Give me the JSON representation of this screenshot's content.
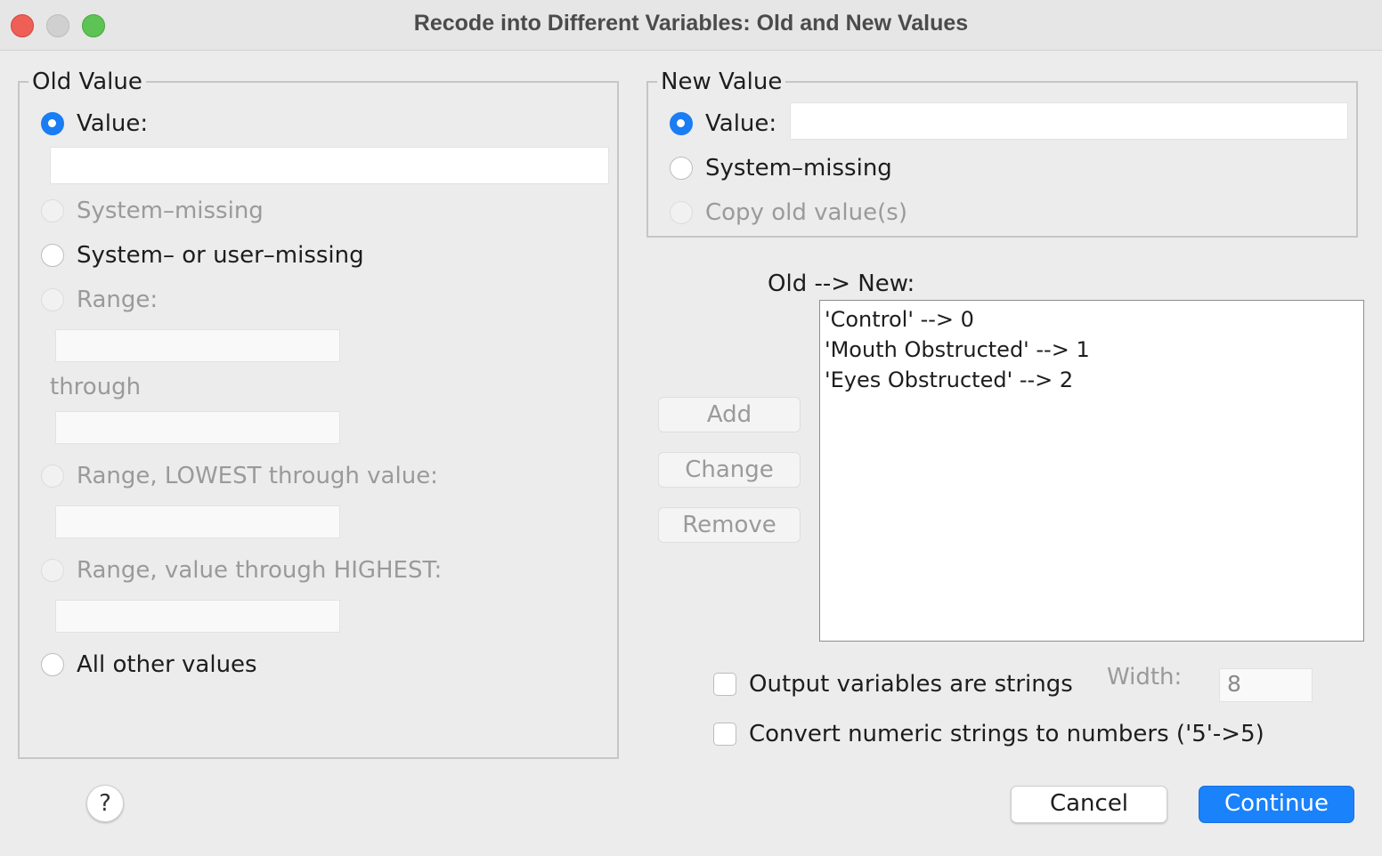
{
  "window": {
    "title": "Recode into Different Variables: Old and New Values"
  },
  "old_value": {
    "legend": "Old Value",
    "value_label": "Value:",
    "value_input": "",
    "system_missing_label": "System–missing",
    "system_or_user_missing_label": "System– or user–missing",
    "range_label": "Range:",
    "range_from": "",
    "through_label": "through",
    "range_to": "",
    "range_lowest_label": "Range, LOWEST through value:",
    "range_lowest_value": "",
    "range_highest_label": "Range, value through HIGHEST:",
    "range_highest_value": "",
    "all_other_label": "All other values",
    "selected": "value"
  },
  "new_value": {
    "legend": "New Value",
    "value_label": "Value:",
    "value_input": "",
    "system_missing_label": "System–missing",
    "copy_old_label": "Copy old value(s)",
    "selected": "value"
  },
  "mapping": {
    "label": "Old --> New:",
    "items": [
      "'Control' --> 0",
      "'Mouth Obstructed' --> 1",
      "'Eyes Obstructed' --> 2"
    ]
  },
  "buttons": {
    "add": "Add",
    "change": "Change",
    "remove": "Remove",
    "help": "?",
    "cancel": "Cancel",
    "continue": "Continue"
  },
  "options": {
    "output_strings_label": "Output variables are strings",
    "output_strings_checked": false,
    "width_label": "Width:",
    "width_value": "8",
    "convert_numeric_label": "Convert numeric strings to numbers ('5'->5)",
    "convert_numeric_checked": false
  },
  "colors": {
    "accent": "#1a82fb",
    "background": "#ececec"
  }
}
